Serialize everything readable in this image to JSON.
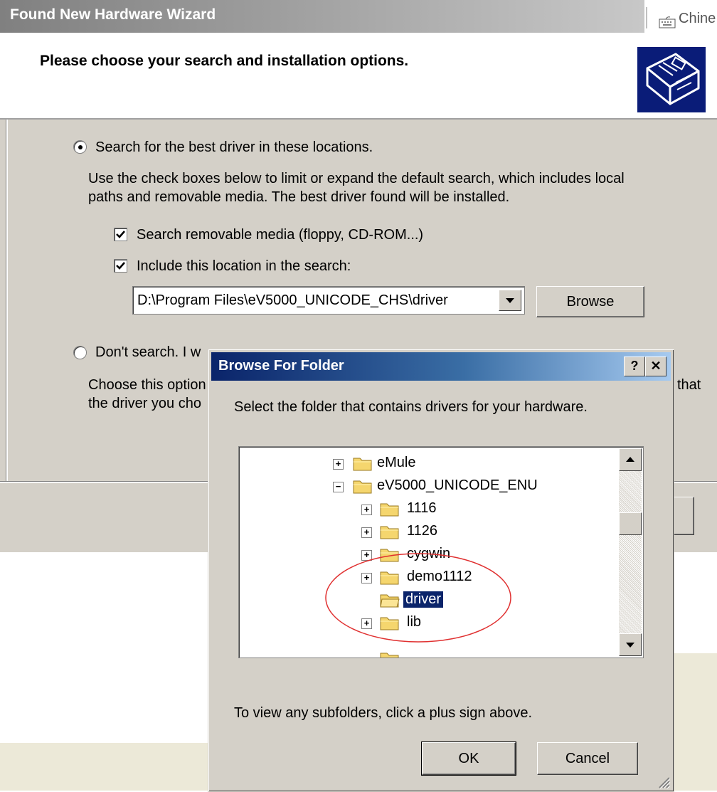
{
  "wizard": {
    "title": "Found New Hardware Wizard",
    "ime_label": "Chine",
    "heading": "Please choose your search and installation options.",
    "option_search": {
      "label": "Search for the best driver in these locations.",
      "selected": true,
      "description_line1": "Use the check boxes below to limit or expand the default search, which includes local",
      "description_line2": "paths and removable media. The best driver found will be installed."
    },
    "check_removable": {
      "label": "Search removable media (floppy, CD-ROM...)",
      "checked": true
    },
    "check_location": {
      "label": "Include this location in the search:",
      "checked": true
    },
    "location_value": "D:\\Program Files\\eV5000_UNICODE_CHS\\driver",
    "browse_label": "Browse",
    "option_dont_search": {
      "label_visible": "Don't search. I w",
      "selected": false,
      "description_line1_visible": "Choose this option",
      "description_line2_visible": "the driver you cho",
      "description_right_visible": "that"
    }
  },
  "browse_dialog": {
    "title": "Browse For Folder",
    "help_label": "?",
    "close_label": "✕",
    "description": "Select the folder that contains drivers for your hardware.",
    "tree": [
      {
        "label": "eMule",
        "expander": "+",
        "level": 0
      },
      {
        "label": "eV5000_UNICODE_ENU",
        "expander": "−",
        "level": 0
      },
      {
        "label": "1116",
        "expander": "+",
        "level": 1
      },
      {
        "label": "1126",
        "expander": "+",
        "level": 1
      },
      {
        "label": "cygwin",
        "expander": "+",
        "level": 1
      },
      {
        "label": "demo1112",
        "expander": "+",
        "level": 1
      },
      {
        "label": "driver",
        "expander": "",
        "level": 1,
        "selected": true
      },
      {
        "label": "lib",
        "expander": "+",
        "level": 1
      }
    ],
    "hint": "To view any subfolders, click a plus sign above.",
    "ok_label": "OK",
    "cancel_label": "Cancel"
  },
  "colors": {
    "dialog_face": "#d4d0c8",
    "active_title_start": "#0a246a",
    "active_title_end": "#a6caf0",
    "inactive_title": "#808080",
    "selection": "#0a246a",
    "highlight_ellipse": "#e03030"
  }
}
